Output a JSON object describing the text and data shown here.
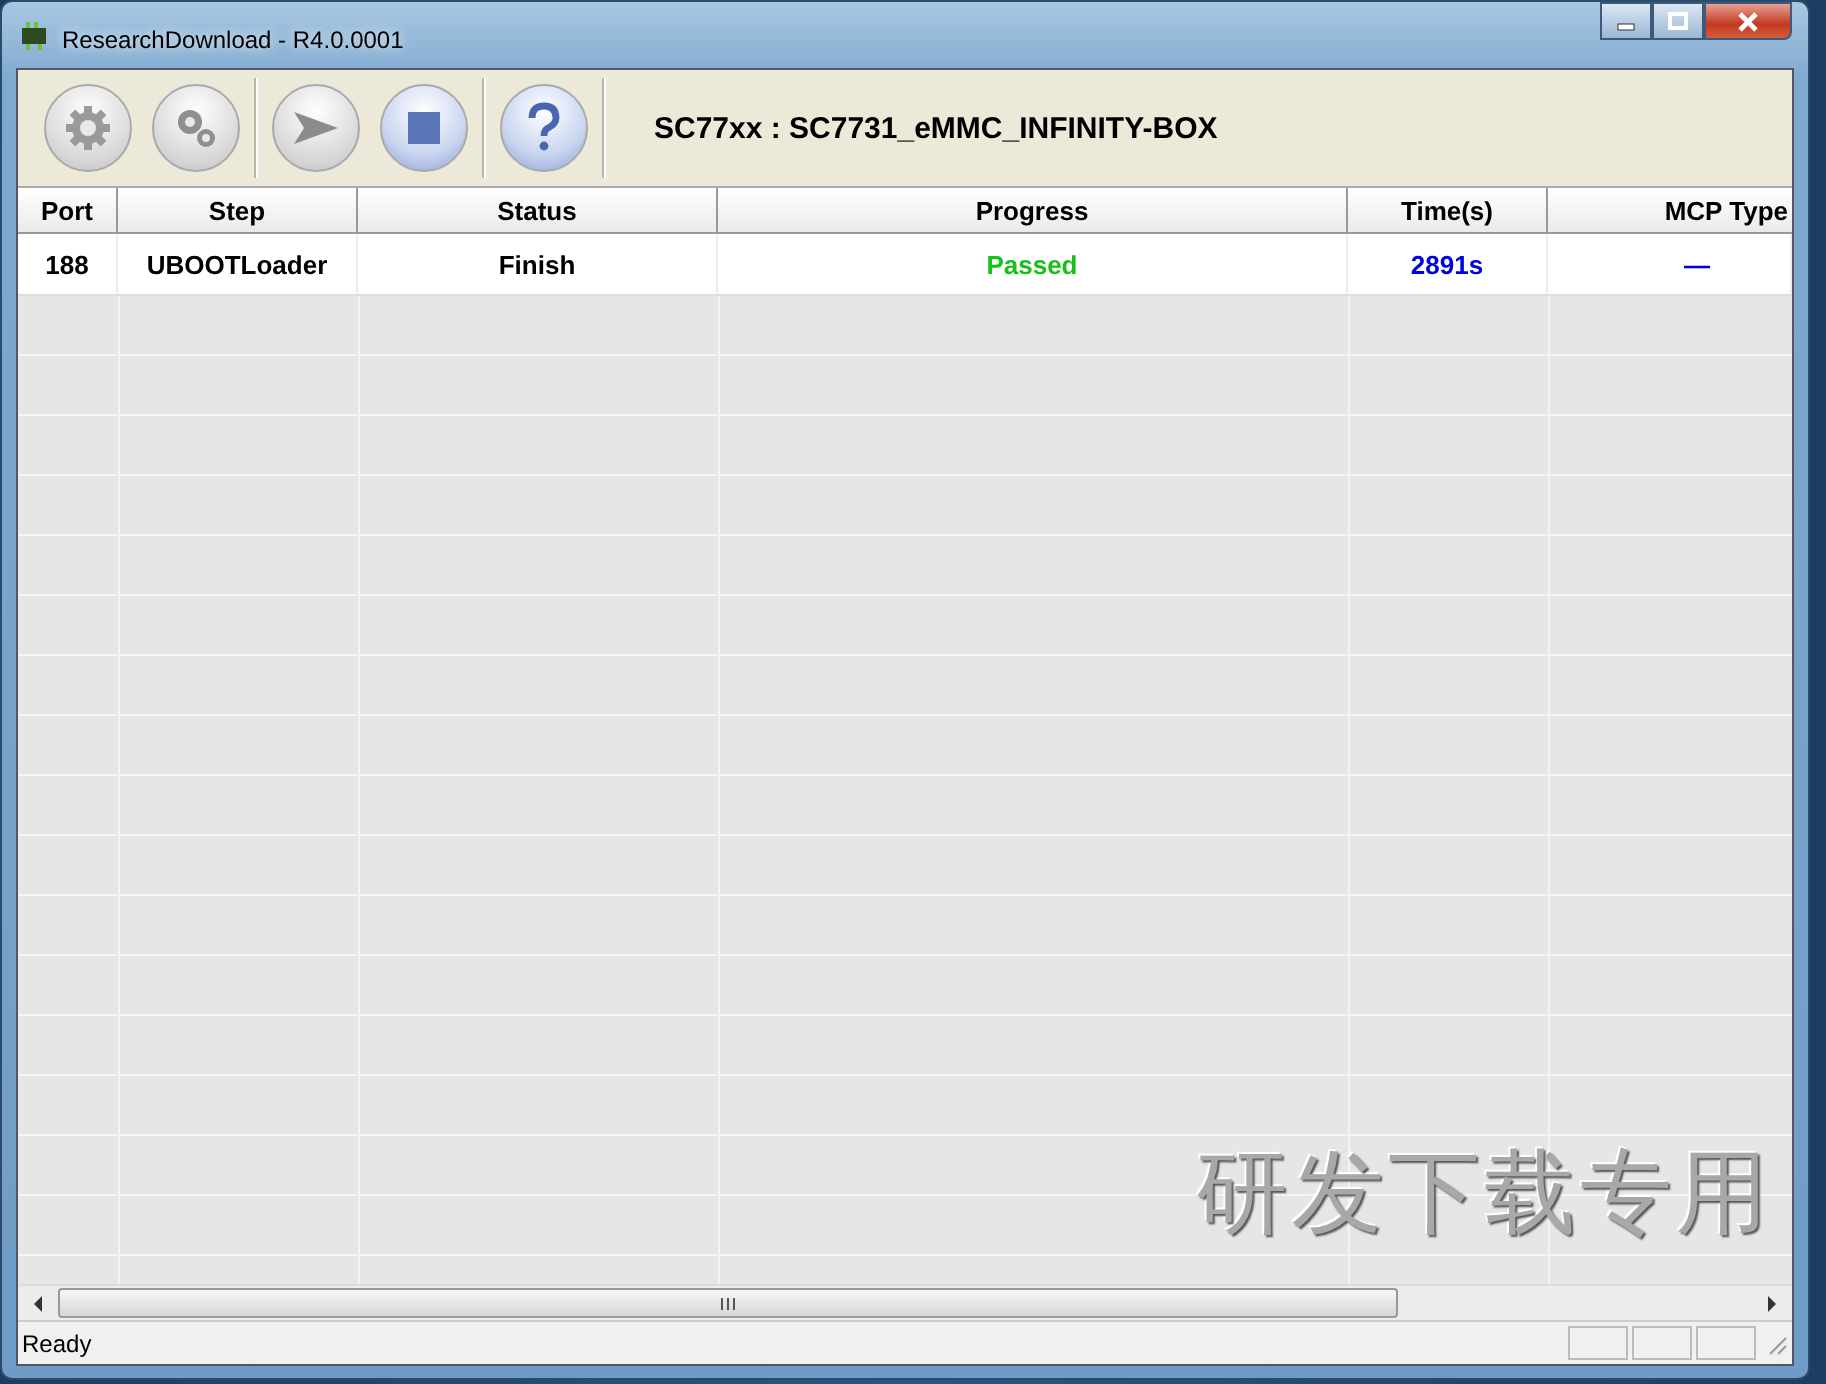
{
  "window": {
    "title": "ResearchDownload - R4.0.0001"
  },
  "toolbar": {
    "buttons": [
      {
        "kind": "settings"
      },
      {
        "kind": "gears"
      },
      {
        "kind": "start"
      },
      {
        "kind": "stop"
      },
      {
        "kind": "help"
      }
    ],
    "label": "SC77xx : SC7731_eMMC_INFINITY-BOX"
  },
  "table": {
    "columns": [
      "Port",
      "Step",
      "Status",
      "Progress",
      "Time(s)",
      "MCP Type"
    ],
    "rows": [
      {
        "cells": [
          "188",
          "UBOOTLoader",
          "Finish",
          "Passed",
          "2891s",
          "—"
        ]
      }
    ]
  },
  "overlay_text": "研发下载专用",
  "status_bar": {
    "text": "Ready"
  }
}
